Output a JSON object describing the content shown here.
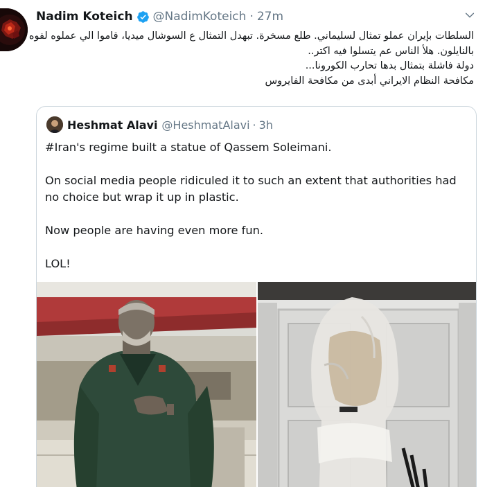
{
  "tweet": {
    "author_name": "Nadim Koteich",
    "author_handle": "@NadimKoteich",
    "separator": "·",
    "time": "27m",
    "verified": true,
    "text_lines": [
      "السلطات بإيران عملو تمثال لسليماني. طلع مسخرة. تبهدل التمثال ع السوشال ميديا، قاموا الي عملوه لفوه",
      "بالنايلون. هلأ الناس عم يتسلوا فيه اكتر..",
      "دولة فاشلة بتمثال بدها تحارب الكورونا...",
      "مكافحة النظام الايراني أبدى من مكافحة الفايروس"
    ],
    "icons": {
      "avatar": "avatar-image",
      "verified": "verified-badge-icon",
      "menu": "chevron-down-icon"
    },
    "colors": {
      "verified": "#1da1f2",
      "secondary_text": "#657786",
      "border": "#ccd6dd"
    }
  },
  "quoted": {
    "author_name": "Heshmat Alavi",
    "author_handle": "@HeshmatAlavi",
    "separator": "·",
    "time": "3h",
    "paragraphs": [
      "#Iran's regime built a statue of Qassem Soleimani.",
      "On social media people ridiculed it to such an extent that authorities had no choice but wrap it up in plastic.",
      "Now people are having even more fun.",
      "LOL!"
    ],
    "photos": [
      {
        "name": "statue-photo"
      },
      {
        "name": "wrapped-statue-photo"
      }
    ]
  }
}
